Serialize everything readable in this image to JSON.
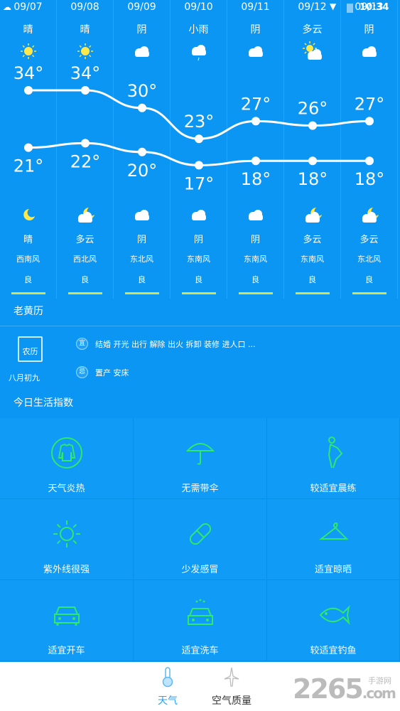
{
  "status_bar": {
    "time": "10:34",
    "icons": [
      "cloud-notification-icon",
      "wifi-icon",
      "no-sim-icon",
      "battery-icon"
    ]
  },
  "forecast": [
    {
      "date": "09/07",
      "day_cond": "晴",
      "day_icon": "sun",
      "high": 34,
      "low": 21,
      "night_icon": "moon",
      "night_cond": "晴",
      "wind": "西南风",
      "aq": "良"
    },
    {
      "date": "09/08",
      "day_cond": "晴",
      "day_icon": "sun",
      "high": 34,
      "low": 22,
      "night_icon": "moon-cloud",
      "night_cond": "多云",
      "wind": "西北风",
      "aq": "良"
    },
    {
      "date": "09/09",
      "day_cond": "阴",
      "day_icon": "cloud",
      "high": 30,
      "low": 20,
      "night_icon": "cloud",
      "night_cond": "阴",
      "wind": "东北风",
      "aq": "良"
    },
    {
      "date": "09/10",
      "day_cond": "小雨",
      "day_icon": "rain",
      "high": 23,
      "low": 17,
      "night_icon": "cloud",
      "night_cond": "阴",
      "wind": "东南风",
      "aq": "良"
    },
    {
      "date": "09/11",
      "day_cond": "阴",
      "day_icon": "cloud",
      "high": 27,
      "low": 18,
      "night_icon": "cloud",
      "night_cond": "阴",
      "wind": "东南风",
      "aq": "良"
    },
    {
      "date": "09/12",
      "day_cond": "多云",
      "day_icon": "sun-cloud",
      "high": 26,
      "low": 18,
      "night_icon": "moon-cloud",
      "night_cond": "多云",
      "wind": "东南风",
      "aq": "良"
    },
    {
      "date": "09/13",
      "day_cond": "阴",
      "day_icon": "cloud",
      "high": 27,
      "low": 18,
      "night_icon": "moon-cloud",
      "night_cond": "多云",
      "wind": "东北风",
      "aq": "良"
    }
  ],
  "temp_unit": "°",
  "aq_color": "#d4e157",
  "almanac": {
    "title": "老黄历",
    "calendar_label": "农历",
    "lunar_date": "八月初九",
    "yi_badge": "宜",
    "yi": "结婚 开光 出行 解除 出火 拆卸 装修 进人口 ...",
    "ji_badge": "忌",
    "ji": "置产 安床"
  },
  "life": {
    "title": "今日生活指数",
    "accent": "#2ee86a",
    "items": [
      {
        "icon": "clothing",
        "label": "天气炎热"
      },
      {
        "icon": "umbrella",
        "label": "无需带伞"
      },
      {
        "icon": "exercise",
        "label": "较适宜晨练"
      },
      {
        "icon": "sun-uv",
        "label": "紫外线很强"
      },
      {
        "icon": "pill",
        "label": "少发感冒"
      },
      {
        "icon": "hanger",
        "label": "适宜晾晒"
      },
      {
        "icon": "car",
        "label": "适宜开车"
      },
      {
        "icon": "car-wash",
        "label": "适宜洗车"
      },
      {
        "icon": "fish",
        "label": "较适宜钓鱼"
      }
    ]
  },
  "tabs": [
    {
      "label": "天气",
      "icon": "thermometer",
      "active": true
    },
    {
      "label": "空气质量",
      "icon": "windmill",
      "active": false
    }
  ],
  "watermark": {
    "text": "2265",
    "suffix": ".com",
    "sub": "手游网"
  }
}
